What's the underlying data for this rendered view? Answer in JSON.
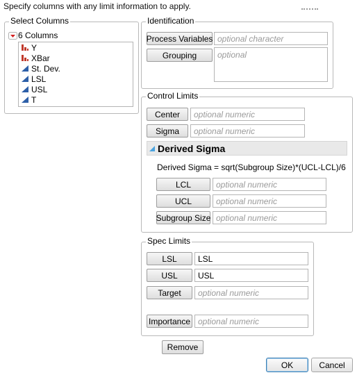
{
  "instructions": "Specify columns with any limit information to apply.",
  "select_columns": {
    "title": "Select Columns",
    "count_label": "6 Columns",
    "columns": [
      {
        "name": "Y",
        "icon": "nominal-bar-icon"
      },
      {
        "name": "XBar",
        "icon": "nominal-bar-icon"
      },
      {
        "name": "St. Dev.",
        "icon": "continuous-triangle-icon"
      },
      {
        "name": "LSL",
        "icon": "continuous-triangle-icon"
      },
      {
        "name": "USL",
        "icon": "continuous-triangle-icon"
      },
      {
        "name": "T",
        "icon": "continuous-triangle-icon"
      }
    ]
  },
  "identification": {
    "title": "Identification",
    "process_variables": {
      "label": "Process Variables",
      "placeholder": "optional character"
    },
    "grouping": {
      "label": "Grouping",
      "placeholder": "optional"
    }
  },
  "control_limits": {
    "title": "Control Limits",
    "center": {
      "label": "Center",
      "placeholder": "optional numeric"
    },
    "sigma": {
      "label": "Sigma",
      "placeholder": "optional numeric"
    },
    "derived_sigma": {
      "title": "Derived Sigma",
      "formula": "Derived Sigma = sqrt(Subgroup Size)*(UCL-LCL)/6",
      "lcl": {
        "label": "LCL",
        "placeholder": "optional numeric"
      },
      "ucl": {
        "label": "UCL",
        "placeholder": "optional numeric"
      },
      "subgroup_size": {
        "label": "Subgroup Size",
        "placeholder": "optional numeric"
      }
    }
  },
  "spec_limits": {
    "title": "Spec Limits",
    "lsl": {
      "label": "LSL",
      "value": "LSL"
    },
    "usl": {
      "label": "USL",
      "value": "USL"
    },
    "target": {
      "label": "Target",
      "placeholder": "optional numeric"
    },
    "importance": {
      "label": "Importance",
      "placeholder": "optional numeric"
    }
  },
  "buttons": {
    "remove": "Remove",
    "ok": "OK",
    "cancel": "Cancel"
  },
  "colors": {
    "nominal_icon": "#c0392b",
    "continuous_icon": "#2d5fa8",
    "disclosure_red": "#d42020",
    "disclosure_blue": "#4aa3df"
  }
}
